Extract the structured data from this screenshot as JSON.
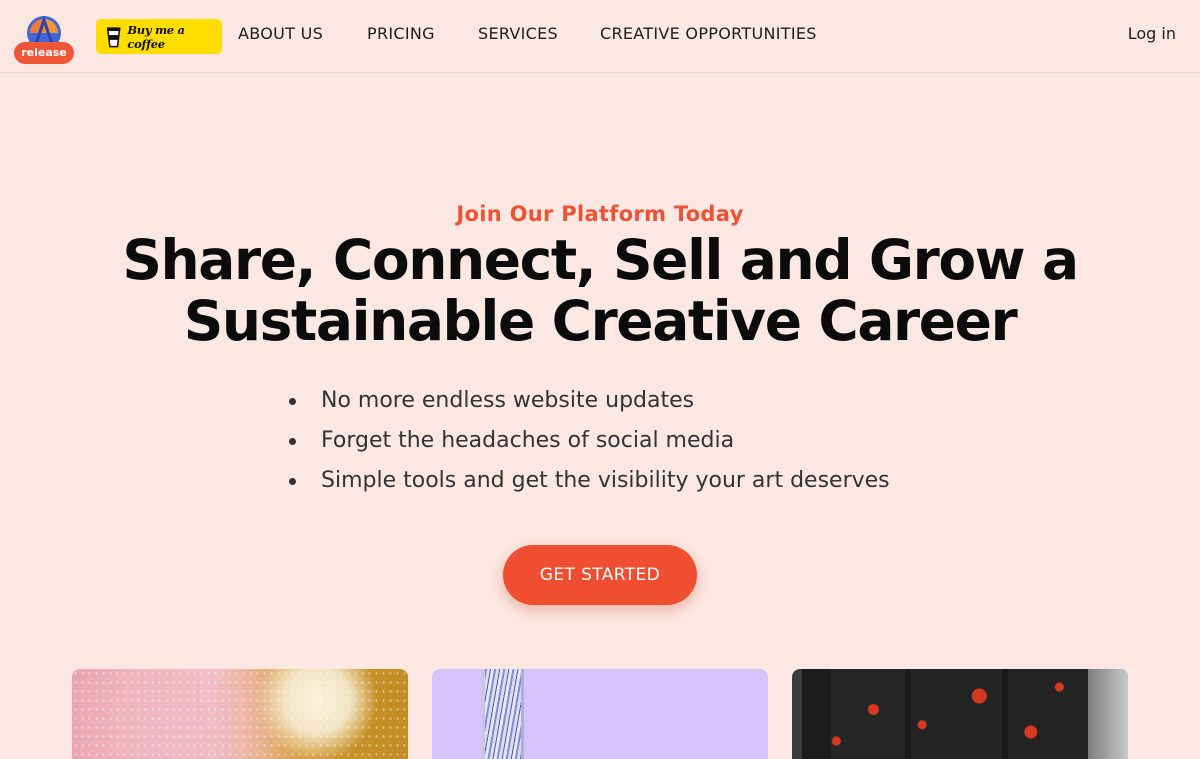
{
  "header": {
    "logo_badge": "release",
    "coffee_button": "Buy me a coffee",
    "nav": [
      {
        "label": "ABOUT US"
      },
      {
        "label": "PRICING"
      },
      {
        "label": "SERVICES"
      },
      {
        "label": "CREATIVE OPPORTUNITIES"
      }
    ],
    "login": "Log in"
  },
  "hero": {
    "eyebrow": "Join Our Platform Today",
    "title": "Share, Connect, Sell and Grow a Sustainable Creative Career",
    "bullets": [
      "No more endless website updates",
      "Forget the headaches of social media",
      "Simple tools and get the visibility your art deserves"
    ],
    "cta": "GET STARTED"
  },
  "colors": {
    "background": "#fce8e3",
    "accent": "#f04e30",
    "coffee": "#ffdd00"
  },
  "icons": [
    "logo-icon",
    "coffee-cup-icon"
  ]
}
